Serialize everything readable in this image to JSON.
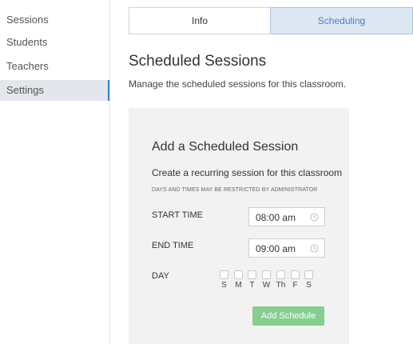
{
  "sidebar": {
    "items": [
      {
        "label": "Sessions",
        "active": false
      },
      {
        "label": "Students",
        "active": false
      },
      {
        "label": "Teachers",
        "active": false
      },
      {
        "label": "Settings",
        "active": true
      }
    ]
  },
  "tabs": {
    "info": "Info",
    "scheduling": "Scheduling",
    "active": "Scheduling"
  },
  "main": {
    "title": "Scheduled Sessions",
    "subtitle": "Manage the scheduled sessions for this classroom."
  },
  "form": {
    "title": "Add a Scheduled Session",
    "description": "Create a recurring session for this classroom",
    "note": "DAYS AND TIMES MAY BE RESTRICTED BY ADMINISTRATOR",
    "start_label": "START TIME",
    "start_value": "08:00 am",
    "end_label": "END TIME",
    "end_value": "09:00 am",
    "day_label": "DAY",
    "days": [
      "S",
      "M",
      "T",
      "W",
      "Th",
      "F",
      "S"
    ],
    "submit_label": "Add Schedule"
  },
  "colors": {
    "accent": "#2f7fd4",
    "active_tab_bg": "#dde7f2",
    "button_green": "#86cf8e",
    "panel_bg": "#f2f2f2"
  },
  "icons": {
    "time_input": "clock-icon"
  }
}
